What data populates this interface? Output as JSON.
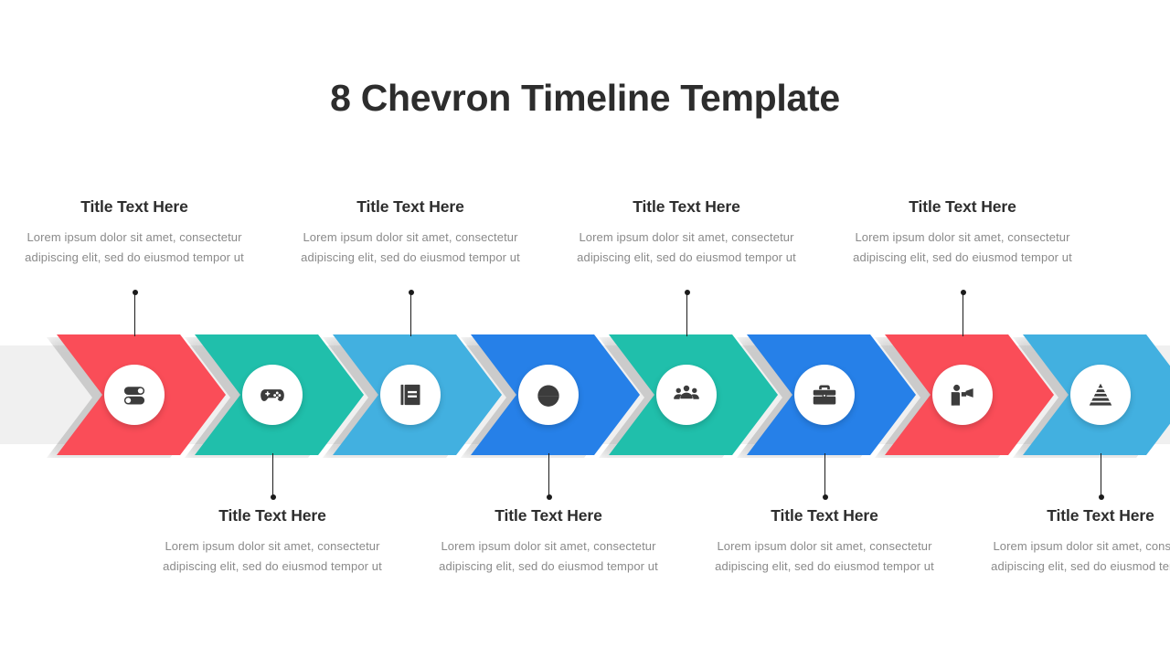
{
  "slide": {
    "title": "8 Chevron Timeline Template",
    "background_color": "#ffffff",
    "band_color": "#f0f0f0",
    "title_color": "#2d2d2d",
    "body_color": "#8a8a8a",
    "icon_color": "#3c3c3c"
  },
  "steps": [
    {
      "index": 1,
      "color": "#fa4d58",
      "icon": "toggle-switches-icon",
      "position": "top",
      "title": "Title Text Here",
      "body": "Lorem ipsum dolor sit amet, consectetur adipiscing elit, sed do eiusmod tempor ut"
    },
    {
      "index": 2,
      "color": "#20bfab",
      "icon": "gamepad-icon",
      "position": "bottom",
      "title": "Title Text Here",
      "body": "Lorem ipsum dolor sit amet, consectetur adipiscing elit, sed do eiusmod tempor ut"
    },
    {
      "index": 3,
      "color": "#42b0e0",
      "icon": "book-icon",
      "position": "top",
      "title": "Title Text Here",
      "body": "Lorem ipsum dolor sit amet, consectetur adipiscing elit, sed do eiusmod tempor ut"
    },
    {
      "index": 4,
      "color": "#2680e8",
      "icon": "pie-chart-icon",
      "position": "bottom",
      "title": "Title Text Here",
      "body": "Lorem ipsum dolor sit amet, consectetur adipiscing elit, sed do eiusmod tempor ut"
    },
    {
      "index": 5,
      "color": "#20bfab",
      "icon": "people-group-icon",
      "position": "top",
      "title": "Title Text Here",
      "body": "Lorem ipsum dolor sit amet, consectetur adipiscing elit, sed do eiusmod tempor ut"
    },
    {
      "index": 6,
      "color": "#2680e8",
      "icon": "briefcase-icon",
      "position": "bottom",
      "title": "Title Text Here",
      "body": "Lorem ipsum dolor sit amet, consectetur adipiscing elit, sed do eiusmod tempor ut"
    },
    {
      "index": 7,
      "color": "#fa4d58",
      "icon": "megaphone-person-icon",
      "position": "top",
      "title": "Title Text Here",
      "body": "Lorem ipsum dolor sit amet, consectetur adipiscing elit, sed do eiusmod tempor ut"
    },
    {
      "index": 8,
      "color": "#42b0e0",
      "icon": "pyramid-icon",
      "position": "bottom",
      "title": "Title Text Here",
      "body": "Lorem ipsum dolor sit amet, consectetur adipiscing elit, sed do eiusmod tempor ut"
    }
  ]
}
